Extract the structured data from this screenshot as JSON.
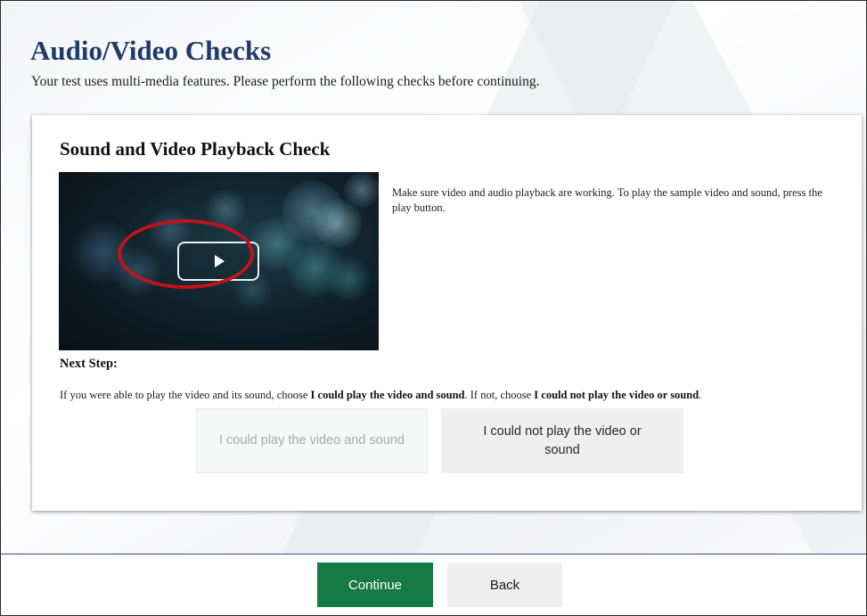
{
  "page": {
    "title": "Audio/Video Checks",
    "subtitle": "Your test uses multi-media features. Please perform the following checks before continuing."
  },
  "card": {
    "title": "Sound and Video Playback Check",
    "instructions": "Make sure video and audio playback are working. To play the sample video and sound, press the play button.",
    "video": {
      "play_icon": "play-icon",
      "highlight_color": "#c0141a"
    },
    "next_step": {
      "label": "Next Step:",
      "text_1": "If you were able to play the video and its sound, choose ",
      "bold_1": "I could play the video and sound",
      "text_2": ". If not, choose ",
      "bold_2": "I could not play the video or sound",
      "text_3": "."
    },
    "choices": {
      "yes_label": "I could play the video and sound",
      "no_label": "I could not play the video or sound"
    }
  },
  "footer": {
    "continue_label": "Continue",
    "back_label": "Back"
  },
  "colors": {
    "title": "#1f3a6b",
    "continue": "#167a45",
    "footer_line": "#3d4e79"
  }
}
